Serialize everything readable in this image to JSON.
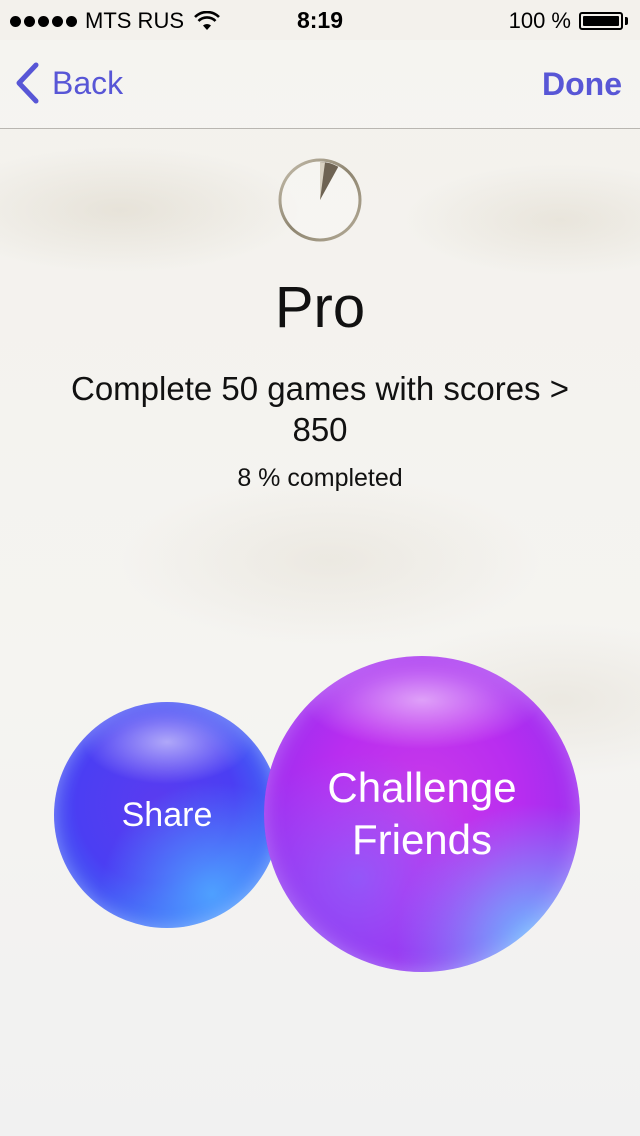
{
  "status_bar": {
    "carrier": "MTS RUS",
    "time": "8:19",
    "battery": "100 %",
    "signal_icon": "signal-dots-icon",
    "wifi_icon": "wifi-icon",
    "battery_icon": "battery-icon"
  },
  "nav": {
    "back_label": "Back",
    "done_label": "Done",
    "accent_color": "#5856d6"
  },
  "achievement": {
    "icon": "progress-pie-icon",
    "title": "Pro",
    "description": "Complete 50 games with scores > 850",
    "progress_text": "8 % completed",
    "progress_fraction": 0.08
  },
  "actions": {
    "share_label": "Share",
    "challenge_line1": "Challenge",
    "challenge_line2": "Friends"
  }
}
